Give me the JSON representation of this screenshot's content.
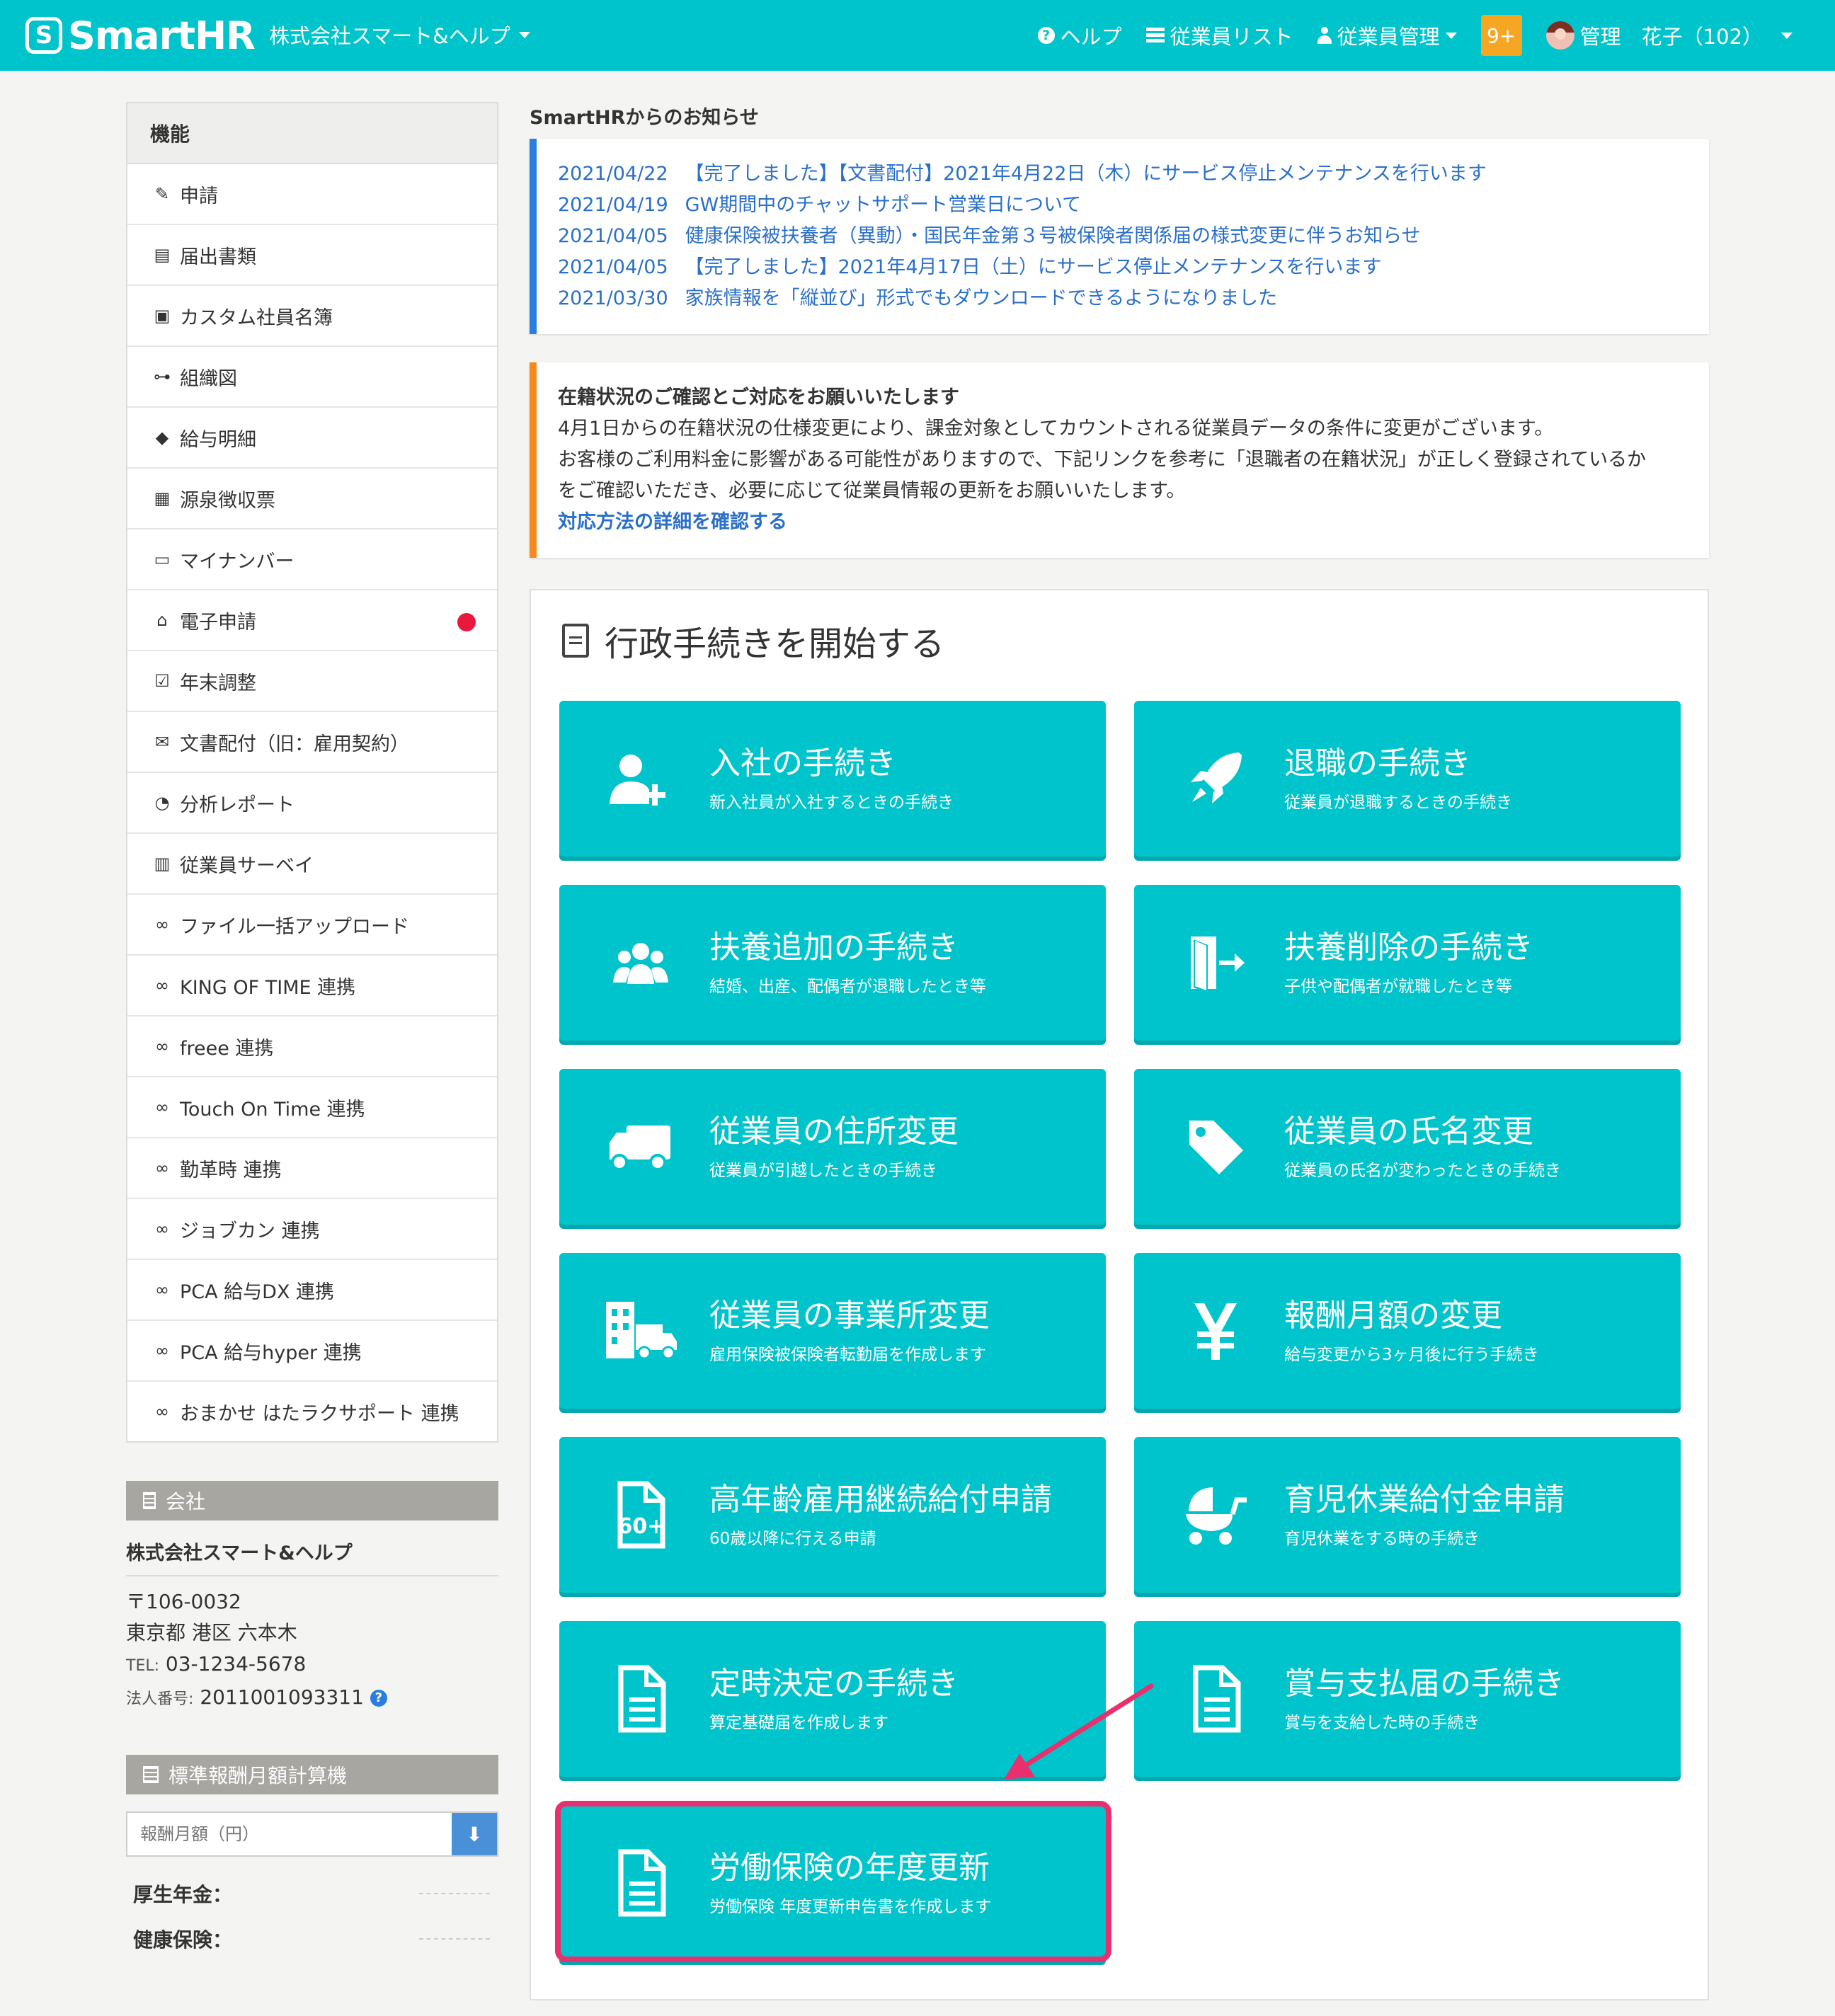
{
  "header": {
    "logo_mark": "S",
    "logo_text": "SmartHR",
    "company": "株式会社スマート&ヘルプ",
    "help_icon": "?",
    "help": "ヘルプ",
    "employee_list": "従業員リスト",
    "employee_manage": "従業員管理",
    "notifications": "9+",
    "user": "管理　花子（102）"
  },
  "sidebar": {
    "heading": "機能",
    "items": [
      {
        "label": "申請",
        "icon": "pen-doc"
      },
      {
        "label": "届出書類",
        "icon": "file"
      },
      {
        "label": "カスタム社員名簿",
        "icon": "id-badge"
      },
      {
        "label": "組織図",
        "icon": "org-chart"
      },
      {
        "label": "給与明細",
        "icon": "yen-gem"
      },
      {
        "label": "源泉徴収票",
        "icon": "calculator"
      },
      {
        "label": "マイナンバー",
        "icon": "id-card"
      },
      {
        "label": "電子申請",
        "icon": "bank"
      },
      {
        "label": "年末調整",
        "icon": "calendar-check"
      },
      {
        "label": "文書配付（旧：雇用契約）",
        "icon": "inbox"
      },
      {
        "label": "分析レポート",
        "icon": "pie-chart"
      },
      {
        "label": "従業員サーベイ",
        "icon": "clipboard"
      },
      {
        "label": "ファイル一括アップロード",
        "icon": "link"
      },
      {
        "label": "KING OF TIME 連携",
        "icon": "link"
      },
      {
        "label": "freee 連携",
        "icon": "link"
      },
      {
        "label": "Touch On Time 連携",
        "icon": "link"
      },
      {
        "label": "勤革時 連携",
        "icon": "link"
      },
      {
        "label": "ジョブカン 連携",
        "icon": "link"
      },
      {
        "label": "PCA 給与DX 連携",
        "icon": "link"
      },
      {
        "label": "PCA 給与hyper 連携",
        "icon": "link"
      },
      {
        "label": "おまかせ はたラクサポート 連携",
        "icon": "link"
      }
    ],
    "company_section": "会社",
    "company_name": "株式会社スマート&ヘルプ",
    "postal": "〒106-0032",
    "address": "東京都 港区 六本木",
    "tel_label": "TEL:",
    "tel": "03-1234-5678",
    "corp_label": "法人番号:",
    "corp_number": "2011001093311",
    "calc_section": "標準報酬月額計算機",
    "calc_placeholder": "報酬月額（円）",
    "calc_pension": "厚生年金：",
    "calc_health": "健康保険："
  },
  "notices": {
    "title": "SmartHRからのお知らせ",
    "items": [
      {
        "date": "2021/04/22",
        "text": "【完了しました】【文書配付】2021年4月22日（木）にサービス停止メンテナンスを行います"
      },
      {
        "date": "2021/04/19",
        "text": "GW期間中のチャットサポート営業日について"
      },
      {
        "date": "2021/04/05",
        "text": "健康保険被扶養者（異動）・国民年金第３号被保険者関係届の様式変更に伴うお知らせ"
      },
      {
        "date": "2021/04/05",
        "text": "【完了しました】2021年4月17日（土）にサービス停止メンテナンスを行います"
      },
      {
        "date": "2021/03/30",
        "text": "家族情報を「縦並び」形式でもダウンロードできるようになりました"
      }
    ]
  },
  "alert": {
    "title": "在籍状況のご確認とご対応をお願いいたします",
    "line1": "4月1日からの在籍状況の仕様変更により、課金対象としてカウントされる従業員データの条件に変更がございます。",
    "line2": "お客様のご利用料金に影響がある可能性がありますので、下記リンクを参考に「退職者の在籍状況」が正しく登録されているか",
    "line3": "をご確認いただき、必要に応じて従業員情報の更新をお願いいたします。",
    "link": "対応方法の詳細を確認する"
  },
  "procedures": {
    "heading": "行政手続きを開始する",
    "tiles": [
      {
        "title": "入社の手続き",
        "sub": "新入社員が入社するときの手続き",
        "icon": "user-plus-icon"
      },
      {
        "title": "退職の手続き",
        "sub": "従業員が退職するときの手続き",
        "icon": "rocket-icon"
      },
      {
        "title": "扶養追加の手続き",
        "sub": "結婚、出産、配偶者が退職したとき等",
        "icon": "users-icon"
      },
      {
        "title": "扶養削除の手続き",
        "sub": "子供や配偶者が就職したとき等",
        "icon": "door-exit-icon"
      },
      {
        "title": "従業員の住所変更",
        "sub": "従業員が引越したときの手続き",
        "icon": "truck-icon"
      },
      {
        "title": "従業員の氏名変更",
        "sub": "従業員の氏名が変わったときの手続き",
        "icon": "tag-icon"
      },
      {
        "title": "従業員の事業所変更",
        "sub": "雇用保険被保険者転勤届を作成します",
        "icon": "building-truck-icon"
      },
      {
        "title": "報酬月額の変更",
        "sub": "給与変更から3ヶ月後に行う手続き",
        "icon": "yen-icon"
      },
      {
        "title": "高年齢雇用継続給付申請",
        "sub": "60歳以降に行える申請",
        "icon": "doc-60-icon"
      },
      {
        "title": "育児休業給付金申請",
        "sub": "育児休業をする時の手続き",
        "icon": "stroller-icon"
      },
      {
        "title": "定時決定の手続き",
        "sub": "算定基礎届を作成します",
        "icon": "document-icon"
      },
      {
        "title": "賞与支払届の手続き",
        "sub": "賞与を支給した時の手続き",
        "icon": "document-icon"
      },
      {
        "title": "労働保険の年度更新",
        "sub": "労働保険 年度更新申告書を作成します",
        "icon": "document-icon"
      }
    ]
  },
  "colors": {
    "brand": "#00c4cc",
    "notice_border": "#2a7de1",
    "alert_border": "#f5891f",
    "highlight": "#e8306e"
  }
}
